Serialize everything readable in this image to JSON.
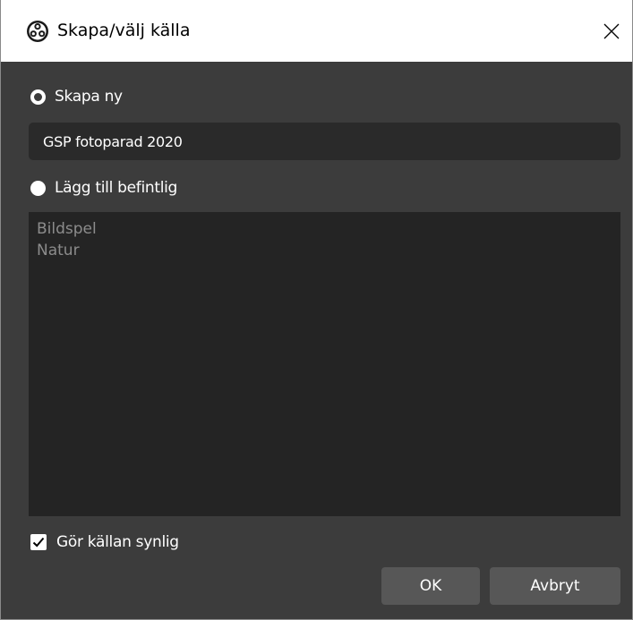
{
  "window": {
    "title": "Skapa/välj källa",
    "app_icon": "obs-logo-icon",
    "close_icon": "close-icon"
  },
  "create_new": {
    "label": "Skapa ny",
    "selected": true,
    "input_value": "GSP fotoparad 2020"
  },
  "add_existing": {
    "label": "Lägg till befintlig",
    "selected": false,
    "items": [
      {
        "label": "Bildspel"
      },
      {
        "label": "Natur"
      }
    ]
  },
  "visible_checkbox": {
    "label": "Gör källan synlig",
    "checked": true
  },
  "buttons": {
    "ok_label": "OK",
    "cancel_label": "Avbryt"
  },
  "colors": {
    "panel": "#3c3c3c",
    "input_bg": "#2a2a2a",
    "list_bg": "#242424",
    "button_bg": "#575757",
    "list_text": "#8c8c8c"
  }
}
